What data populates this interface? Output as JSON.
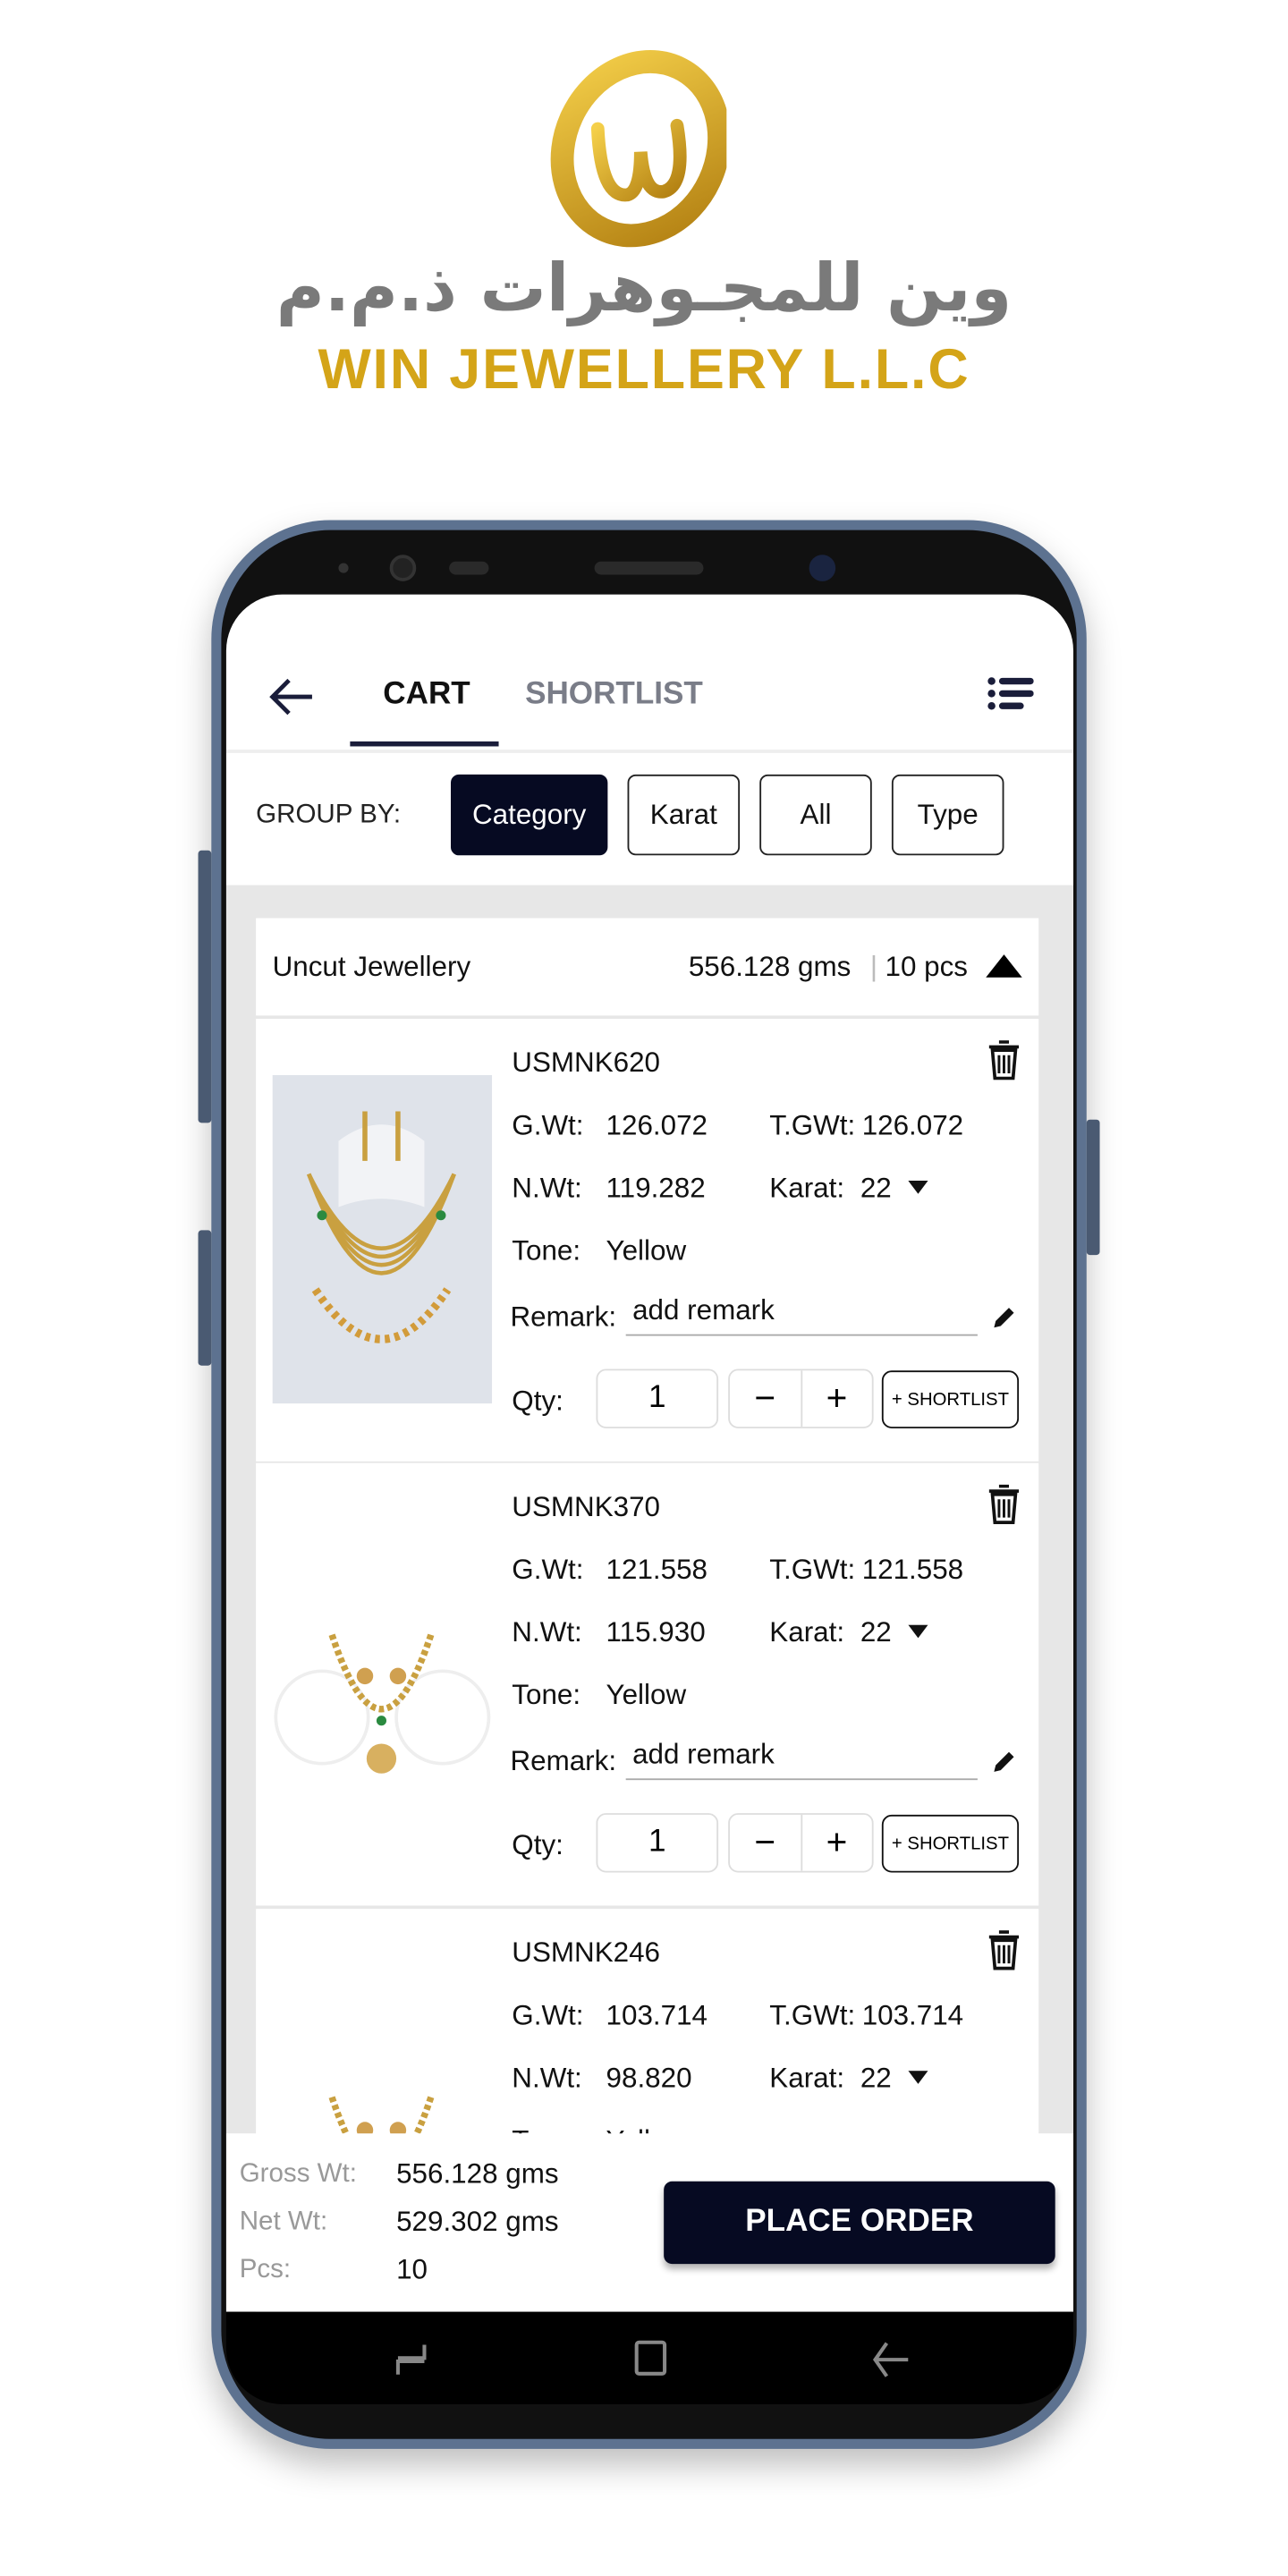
{
  "brand": {
    "logo_text_arabic": "وين للمجـوهرات ذ.م.م",
    "logo_text_english": "WIN JEWELLERY L.L.C",
    "gold": "#d4a418"
  },
  "header": {
    "tabs": [
      {
        "label": "CART",
        "active": true
      },
      {
        "label": "SHORTLIST",
        "active": false
      }
    ]
  },
  "group_by": {
    "label": "GROUP BY:",
    "options": [
      "Category",
      "Karat",
      "All",
      "Type"
    ],
    "selected": "Category"
  },
  "group": {
    "name": "Uncut Jewellery",
    "weight": "556.128 gms",
    "separator": "|",
    "count": "10 pcs"
  },
  "items": [
    {
      "code": "USMNK620",
      "gwt_label": "G.Wt:",
      "gwt": "126.072",
      "tgwt_label": "T.GWt:",
      "tgwt": "126.072",
      "nwt_label": "N.Wt:",
      "nwt": "119.282",
      "karat_label": "Karat:",
      "karat": "22",
      "tone_label": "Tone:",
      "tone": "Yellow",
      "remark_label": "Remark:",
      "remark_placeholder": "add remark",
      "qty_label": "Qty:",
      "qty": "1",
      "shortlist_label": "+ SHORTLIST"
    },
    {
      "code": "USMNK370",
      "gwt_label": "G.Wt:",
      "gwt": "121.558",
      "tgwt_label": "T.GWt:",
      "tgwt": "121.558",
      "nwt_label": "N.Wt:",
      "nwt": "115.930",
      "karat_label": "Karat:",
      "karat": "22",
      "tone_label": "Tone:",
      "tone": "Yellow",
      "remark_label": "Remark:",
      "remark_placeholder": "add remark",
      "qty_label": "Qty:",
      "qty": "1",
      "shortlist_label": "+ SHORTLIST"
    },
    {
      "code": "USMNK246",
      "gwt_label": "G.Wt:",
      "gwt": "103.714",
      "tgwt_label": "T.GWt:",
      "tgwt": "103.714",
      "nwt_label": "N.Wt:",
      "nwt": "98.820",
      "karat_label": "Karat:",
      "karat": "22",
      "tone_label": "Tone:",
      "tone": "Yellow"
    }
  ],
  "footer": {
    "gross_label": "Gross Wt:",
    "gross": "556.128 gms",
    "net_label": "Net Wt:",
    "net": "529.302 gms",
    "pcs_label": "Pcs:",
    "pcs": "10",
    "place_order": "PLACE ORDER"
  },
  "colors": {
    "primary": "#060a22",
    "inactive_tab": "#7a7d88"
  }
}
